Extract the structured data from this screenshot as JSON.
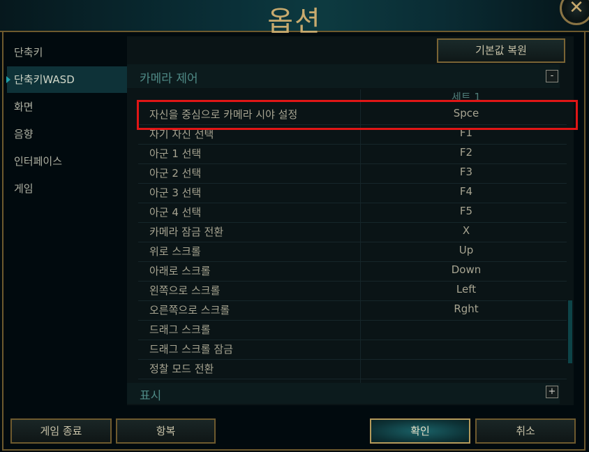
{
  "window": {
    "title": "옵션",
    "close_icon": "✕"
  },
  "sidebar": {
    "items": [
      {
        "label": "단축키"
      },
      {
        "label": "단축키WASD"
      },
      {
        "label": "화면"
      },
      {
        "label": "음향"
      },
      {
        "label": "인터페이스"
      },
      {
        "label": "게임"
      }
    ]
  },
  "panel": {
    "restore_label": "기본값 복원",
    "section_camera": "카메라 제어",
    "collapse_symbol": "-",
    "column_header": "세트 1",
    "rows": [
      {
        "action": "자신을 중심으로 카메라 시야 설정",
        "key": "Spce"
      },
      {
        "action": "자기 자신 선택",
        "key": "F1"
      },
      {
        "action": "아군 1 선택",
        "key": "F2"
      },
      {
        "action": "아군 2 선택",
        "key": "F3"
      },
      {
        "action": "아군 3 선택",
        "key": "F4"
      },
      {
        "action": "아군 4 선택",
        "key": "F5"
      },
      {
        "action": "카메라 잠금 전환",
        "key": "X"
      },
      {
        "action": "위로 스크롤",
        "key": "Up"
      },
      {
        "action": "아래로 스크롤",
        "key": "Down"
      },
      {
        "action": "왼쪽으로 스크롤",
        "key": "Left"
      },
      {
        "action": "오른쪽으로 스크롤",
        "key": "Rght"
      },
      {
        "action": "드래그 스크롤",
        "key": ""
      },
      {
        "action": "드래그 스크롤 잠금",
        "key": ""
      },
      {
        "action": "정찰 모드 전환",
        "key": ""
      }
    ],
    "section_display": "표시",
    "expand_symbol": "+"
  },
  "footer": {
    "quit_label": "게임 종료",
    "surrender_label": "항복",
    "ok_label": "확인",
    "cancel_label": "취소"
  },
  "colors": {
    "accent_gold": "#c8aa6e",
    "highlight_red": "#e01616",
    "section_teal": "#4f8a86"
  }
}
